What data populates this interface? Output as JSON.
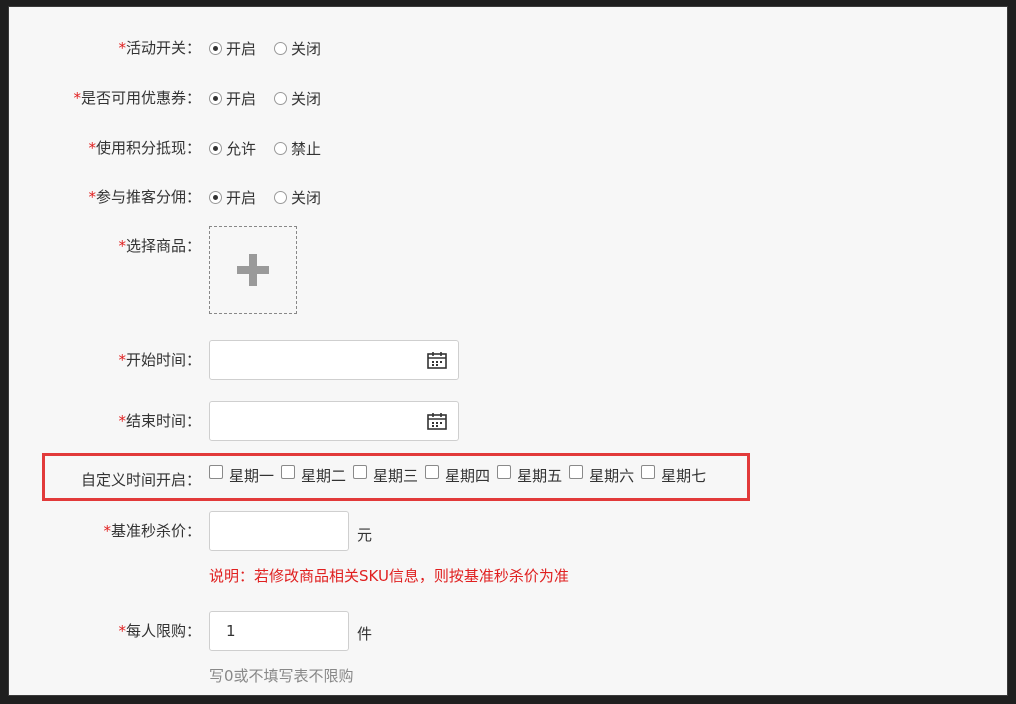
{
  "form": {
    "activity_switch": {
      "required": "*",
      "label": "活动开关：",
      "options": [
        "开启",
        "关闭"
      ],
      "selected": 0
    },
    "coupon": {
      "required": "*",
      "label": "是否可用优惠券：",
      "options": [
        "开启",
        "关闭"
      ],
      "selected": 0
    },
    "points": {
      "required": "*",
      "label": "使用积分抵现：",
      "options": [
        "允许",
        "禁止"
      ],
      "selected": 0
    },
    "referral": {
      "required": "*",
      "label": "参与推客分佣：",
      "options": [
        "开启",
        "关闭"
      ],
      "selected": 0
    },
    "product": {
      "required": "*",
      "label": "选择商品："
    },
    "start_time": {
      "required": "*",
      "label": "开始时间：",
      "value": ""
    },
    "end_time": {
      "required": "*",
      "label": "结束时间：",
      "value": ""
    },
    "custom_days": {
      "label": "自定义时间开启：",
      "days": [
        "星期一",
        "星期二",
        "星期三",
        "星期四",
        "星期五",
        "星期六",
        "星期七"
      ]
    },
    "base_price": {
      "required": "*",
      "label": "基准秒杀价：",
      "value": "",
      "unit": "元",
      "note": "说明：若修改商品相关SKU信息，则按基准秒杀价为准"
    },
    "limit": {
      "required": "*",
      "label": "每人限购：",
      "value": "1",
      "unit": "件",
      "note": "写0或不填写表不限购"
    }
  },
  "colors": {
    "required": "#e02020",
    "highlight_border": "#e23a3a",
    "note_gray": "#888888"
  }
}
